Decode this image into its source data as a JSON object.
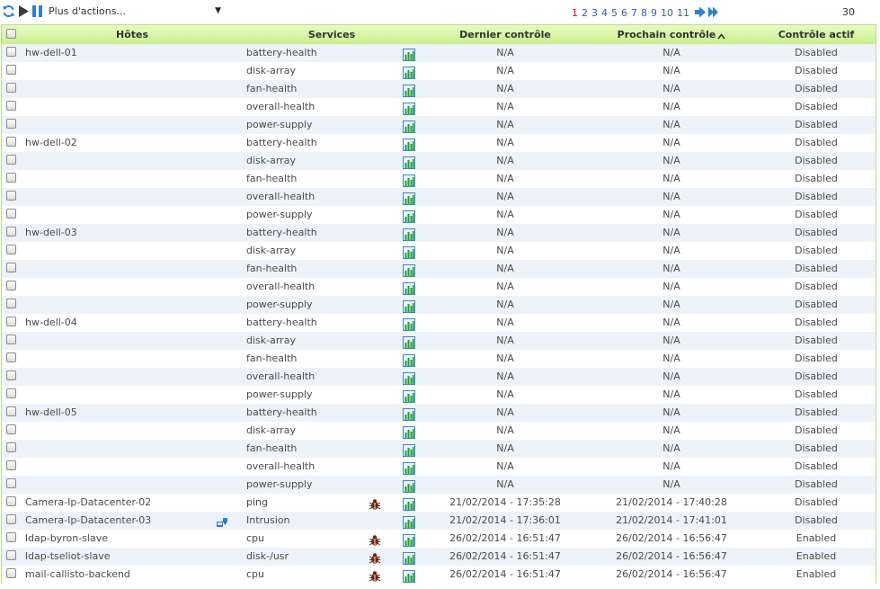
{
  "toolbar": {
    "refresh_icon": "refresh-icon",
    "play_icon": "play-icon",
    "pause_icon": "pause-icon",
    "actions_label": "Plus d'actions...",
    "actions_caret": "▼",
    "pages": [
      "1",
      "2",
      "3",
      "4",
      "5",
      "6",
      "7",
      "8",
      "9",
      "10",
      "11"
    ],
    "current_page": "1",
    "next_icon": "next-page-icon",
    "last_icon": "last-page-icon",
    "per_page": "30"
  },
  "colors": {
    "header_gradient_top": "#e8fbc4",
    "header_gradient_bottom": "#c9f08c",
    "row_alt": "#eef3fb",
    "page_link": "#3b5ea8",
    "page_active": "#c8102e"
  },
  "table": {
    "columns": {
      "hosts": "Hôtes",
      "services": "Services",
      "last_check": "Dernier contrôle",
      "next_check": "Prochain contrôle",
      "active_check": "Contrôle actif"
    },
    "sorted_column": "next_check",
    "rows": [
      {
        "host": "hw-dell-01",
        "service": "battery-health",
        "last": "N/A",
        "next": "N/A",
        "active": "Disabled",
        "ack": false,
        "host_icon": false
      },
      {
        "host": "",
        "service": "disk-array",
        "last": "N/A",
        "next": "N/A",
        "active": "Disabled",
        "ack": false,
        "host_icon": false
      },
      {
        "host": "",
        "service": "fan-health",
        "last": "N/A",
        "next": "N/A",
        "active": "Disabled",
        "ack": false,
        "host_icon": false
      },
      {
        "host": "",
        "service": "overall-health",
        "last": "N/A",
        "next": "N/A",
        "active": "Disabled",
        "ack": false,
        "host_icon": false
      },
      {
        "host": "",
        "service": "power-supply",
        "last": "N/A",
        "next": "N/A",
        "active": "Disabled",
        "ack": false,
        "host_icon": false
      },
      {
        "host": "hw-dell-02",
        "service": "battery-health",
        "last": "N/A",
        "next": "N/A",
        "active": "Disabled",
        "ack": false,
        "host_icon": false
      },
      {
        "host": "",
        "service": "disk-array",
        "last": "N/A",
        "next": "N/A",
        "active": "Disabled",
        "ack": false,
        "host_icon": false
      },
      {
        "host": "",
        "service": "fan-health",
        "last": "N/A",
        "next": "N/A",
        "active": "Disabled",
        "ack": false,
        "host_icon": false
      },
      {
        "host": "",
        "service": "overall-health",
        "last": "N/A",
        "next": "N/A",
        "active": "Disabled",
        "ack": false,
        "host_icon": false
      },
      {
        "host": "",
        "service": "power-supply",
        "last": "N/A",
        "next": "N/A",
        "active": "Disabled",
        "ack": false,
        "host_icon": false
      },
      {
        "host": "hw-dell-03",
        "service": "battery-health",
        "last": "N/A",
        "next": "N/A",
        "active": "Disabled",
        "ack": false,
        "host_icon": false
      },
      {
        "host": "",
        "service": "disk-array",
        "last": "N/A",
        "next": "N/A",
        "active": "Disabled",
        "ack": false,
        "host_icon": false
      },
      {
        "host": "",
        "service": "fan-health",
        "last": "N/A",
        "next": "N/A",
        "active": "Disabled",
        "ack": false,
        "host_icon": false
      },
      {
        "host": "",
        "service": "overall-health",
        "last": "N/A",
        "next": "N/A",
        "active": "Disabled",
        "ack": false,
        "host_icon": false
      },
      {
        "host": "",
        "service": "power-supply",
        "last": "N/A",
        "next": "N/A",
        "active": "Disabled",
        "ack": false,
        "host_icon": false
      },
      {
        "host": "hw-dell-04",
        "service": "battery-health",
        "last": "N/A",
        "next": "N/A",
        "active": "Disabled",
        "ack": false,
        "host_icon": false
      },
      {
        "host": "",
        "service": "disk-array",
        "last": "N/A",
        "next": "N/A",
        "active": "Disabled",
        "ack": false,
        "host_icon": false
      },
      {
        "host": "",
        "service": "fan-health",
        "last": "N/A",
        "next": "N/A",
        "active": "Disabled",
        "ack": false,
        "host_icon": false
      },
      {
        "host": "",
        "service": "overall-health",
        "last": "N/A",
        "next": "N/A",
        "active": "Disabled",
        "ack": false,
        "host_icon": false
      },
      {
        "host": "",
        "service": "power-supply",
        "last": "N/A",
        "next": "N/A",
        "active": "Disabled",
        "ack": false,
        "host_icon": false
      },
      {
        "host": "hw-dell-05",
        "service": "battery-health",
        "last": "N/A",
        "next": "N/A",
        "active": "Disabled",
        "ack": false,
        "host_icon": false
      },
      {
        "host": "",
        "service": "disk-array",
        "last": "N/A",
        "next": "N/A",
        "active": "Disabled",
        "ack": false,
        "host_icon": false
      },
      {
        "host": "",
        "service": "fan-health",
        "last": "N/A",
        "next": "N/A",
        "active": "Disabled",
        "ack": false,
        "host_icon": false
      },
      {
        "host": "",
        "service": "overall-health",
        "last": "N/A",
        "next": "N/A",
        "active": "Disabled",
        "ack": false,
        "host_icon": false
      },
      {
        "host": "",
        "service": "power-supply",
        "last": "N/A",
        "next": "N/A",
        "active": "Disabled",
        "ack": false,
        "host_icon": false
      },
      {
        "host": "Camera-Ip-Datacenter-02",
        "service": "ping",
        "last": "21/02/2014 - 17:35:28",
        "next": "21/02/2014 - 17:40:28",
        "active": "Disabled",
        "ack": true,
        "host_icon": false
      },
      {
        "host": "Camera-Ip-Datacenter-03",
        "service": "Intrusion",
        "last": "21/02/2014 - 17:36:01",
        "next": "21/02/2014 - 17:41:01",
        "active": "Disabled",
        "ack": false,
        "host_icon": true
      },
      {
        "host": "ldap-byron-slave",
        "service": "cpu",
        "last": "26/02/2014 - 16:51:47",
        "next": "26/02/2014 - 16:56:47",
        "active": "Enabled",
        "ack": true,
        "host_icon": false
      },
      {
        "host": "ldap-tseliot-slave",
        "service": "disk-/usr",
        "last": "26/02/2014 - 16:51:47",
        "next": "26/02/2014 - 16:56:47",
        "active": "Enabled",
        "ack": true,
        "host_icon": false
      },
      {
        "host": "mail-callisto-backend",
        "service": "cpu",
        "last": "26/02/2014 - 16:51:47",
        "next": "26/02/2014 - 16:56:47",
        "active": "Enabled",
        "ack": true,
        "host_icon": false
      }
    ]
  }
}
